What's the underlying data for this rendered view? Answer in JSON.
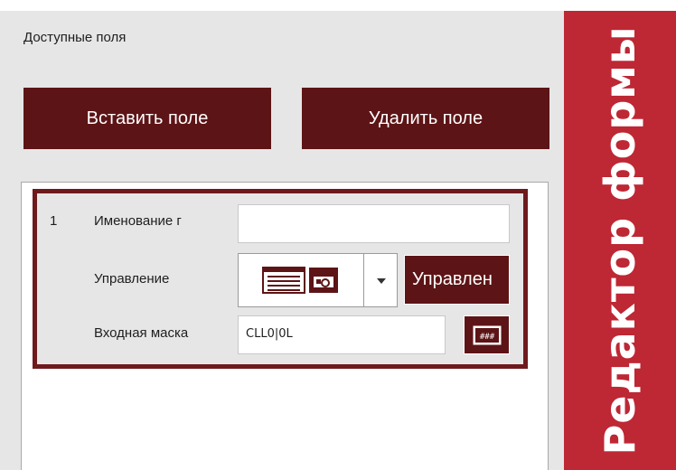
{
  "side_title": "Редактор формы",
  "available_fields_label": "Доступные поля",
  "buttons": {
    "insert_field": "Вставить поле",
    "delete_field": "Удалить поле"
  },
  "field": {
    "number": "1",
    "name_label": "Именование г",
    "name_value": "",
    "control_label": "Управление",
    "control_icon": "form-control-icon",
    "manage_button": "Управлен",
    "mask_label": "Входная маска",
    "mask_value": "CLL0|0L",
    "mask_icon": "input-mask-icon"
  },
  "colors": {
    "accent_red": "#be2734",
    "dark_maroon": "#5d1416",
    "card_border": "#6e1a1d",
    "panel_gray": "#e6e6e6"
  }
}
